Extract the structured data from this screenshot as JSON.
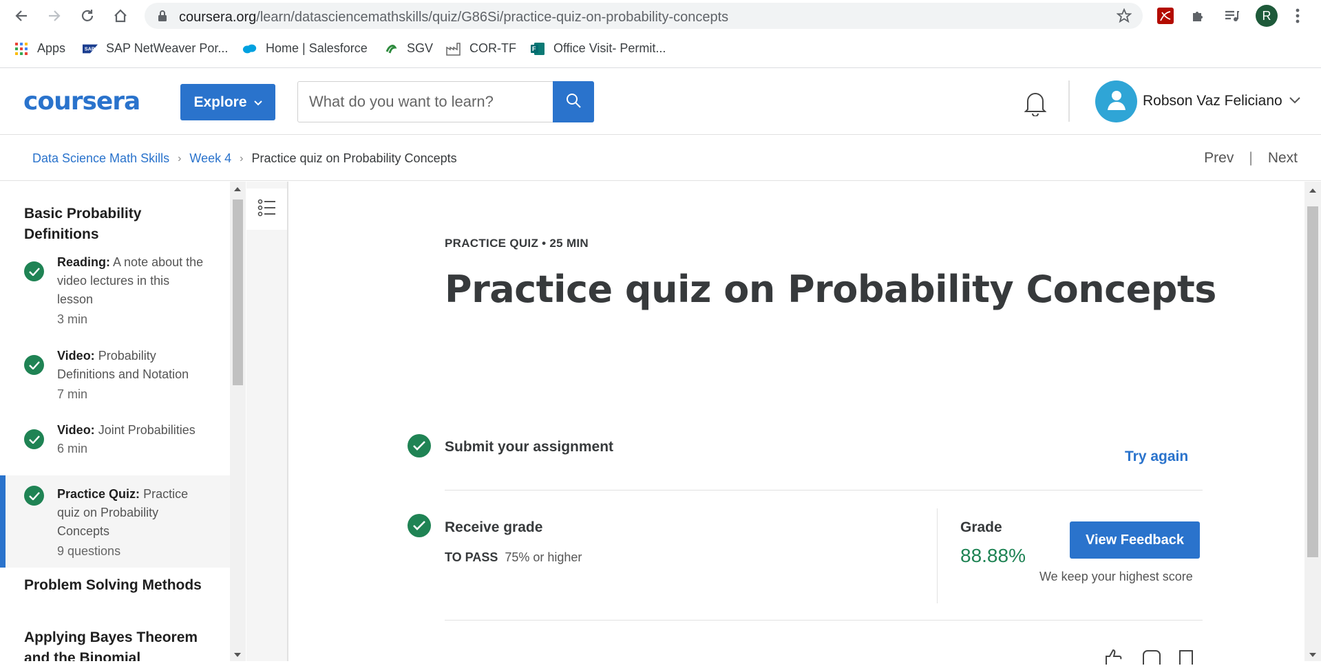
{
  "browser": {
    "url_host": "coursera.org",
    "url_path": "/learn/datasciencemathskills/quiz/G86Si/practice-quiz-on-probability-concepts",
    "profile_initial": "R",
    "bookmarks": [
      {
        "label": "Apps",
        "icon": "apps-grid-icon"
      },
      {
        "label": "SAP NetWeaver Por...",
        "icon": "sap-icon"
      },
      {
        "label": "Home | Salesforce",
        "icon": "salesforce-cloud-icon"
      },
      {
        "label": "SGV",
        "icon": "sgv-icon"
      },
      {
        "label": "COR-TF",
        "icon": "factory-icon"
      },
      {
        "label": "Office Visit- Permit...",
        "icon": "forms-icon"
      }
    ]
  },
  "header": {
    "logo": "coursera",
    "explore_label": "Explore",
    "search_placeholder": "What do you want to learn?",
    "user_name": "Robson Vaz Feliciano"
  },
  "breadcrumb": {
    "items": [
      "Data Science Math Skills",
      "Week 4"
    ],
    "current": "Practice quiz on Probability Concepts",
    "prev": "Prev",
    "next": "Next",
    "divider": "|"
  },
  "sidebar": {
    "sections": [
      "Basic Probability Definitions",
      "Problem Solving Methods",
      "Applying Bayes Theorem and the Binomial"
    ],
    "items": [
      {
        "type": "Reading:",
        "title": "A note about the video lectures in this lesson",
        "meta": "3 min",
        "done": true
      },
      {
        "type": "Video:",
        "title": "Probability Definitions and Notation",
        "meta": "7 min",
        "done": true
      },
      {
        "type": "Video:",
        "title": "Joint Probabilities",
        "meta": "6 min",
        "done": true
      },
      {
        "type": "Practice Quiz:",
        "title": "Practice quiz on Probability Concepts",
        "meta": "9 questions",
        "done": true,
        "active": true
      }
    ]
  },
  "main": {
    "kicker": "PRACTICE QUIZ • 25 MIN",
    "title": "Practice quiz on Probability Concepts",
    "submit_title": "Submit your assignment",
    "try_again": "Try again",
    "receive_title": "Receive grade",
    "to_pass_label": "TO PASS",
    "to_pass_value": "75% or higher",
    "grade_label": "Grade",
    "grade_value": "88.88%",
    "view_feedback": "View Feedback",
    "keep_score": "We keep your highest score"
  },
  "colors": {
    "brand_blue": "#2a73cc",
    "success_green": "#1f8354",
    "avatar_cyan": "#2fa5d6"
  }
}
